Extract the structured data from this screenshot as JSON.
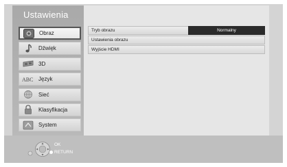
{
  "menu": {
    "title": "Ustawienia",
    "items": [
      {
        "label": "Obraz",
        "icon": "picture-icon",
        "selected": true
      },
      {
        "label": "Dźwięk",
        "icon": "music-note-icon",
        "selected": false
      },
      {
        "label": "3D",
        "icon": "3d-glasses-icon",
        "selected": false
      },
      {
        "label": "Język",
        "icon": "abc-language-icon",
        "selected": false
      },
      {
        "label": "Sieć",
        "icon": "network-icon",
        "selected": false
      },
      {
        "label": "Klasyfikacja",
        "icon": "lock-icon",
        "selected": false
      },
      {
        "label": "System",
        "icon": "system-icon",
        "selected": false
      }
    ]
  },
  "settings": {
    "rows": [
      {
        "label": "Tryb obrazu",
        "value": "Normalny"
      },
      {
        "label": "Ustawienia obrazu"
      },
      {
        "label": "Wyjście HDMI"
      }
    ]
  },
  "footer": {
    "ok_label": "OK",
    "return_label": "RETURN"
  },
  "colors": {
    "selected_value_bg": "#2b2b2b",
    "panel_bg": "#d4d4d4"
  }
}
